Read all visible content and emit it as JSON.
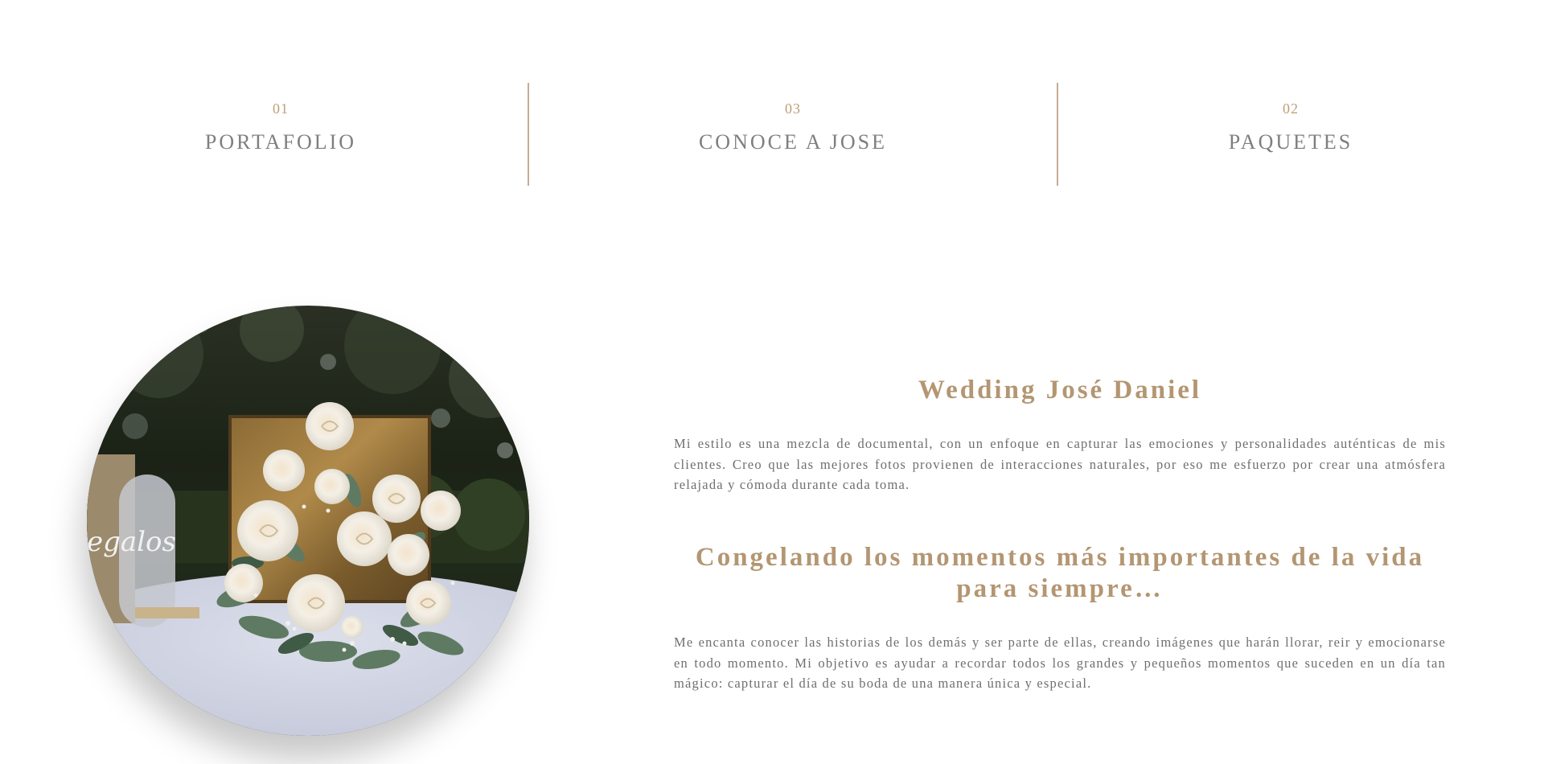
{
  "nav": {
    "items": [
      {
        "number": "01",
        "label": "PORTAFOLIO"
      },
      {
        "number": "03",
        "label": "CONOCE A JOSE"
      },
      {
        "number": "02",
        "label": "PAQUETES"
      }
    ]
  },
  "photo": {
    "sign_text": "egalos",
    "alt": "white roses floral arrangement on a table"
  },
  "about": {
    "title": "Wedding José Daniel",
    "paragraph1": "Mi estilo es una mezcla de documental, con un enfoque en capturar las emociones y personalidades auténticas de mis clientes. Creo que las mejores fotos provienen de interacciones naturales, por eso me esfuerzo por crear una atmósfera relajada y cómoda durante cada toma.",
    "subtitle": "Congelando los momentos más importantes de la vida para siempre…",
    "paragraph2": "Me encanta conocer las historias de los demás y ser parte de ellas, creando imágenes que harán llorar, reir y emocionarse en todo momento. Mi objetivo es ayudar a recordar todos los grandes y pequeños momentos que suceden en un día tan mágico: capturar el día de su boda de una manera única y especial."
  },
  "colors": {
    "accent_gold": "#b39672",
    "number_gold": "#c09e79",
    "divider": "#c6ab92",
    "nav_label": "#7f7f7f",
    "body_text": "#6f6f6f"
  }
}
